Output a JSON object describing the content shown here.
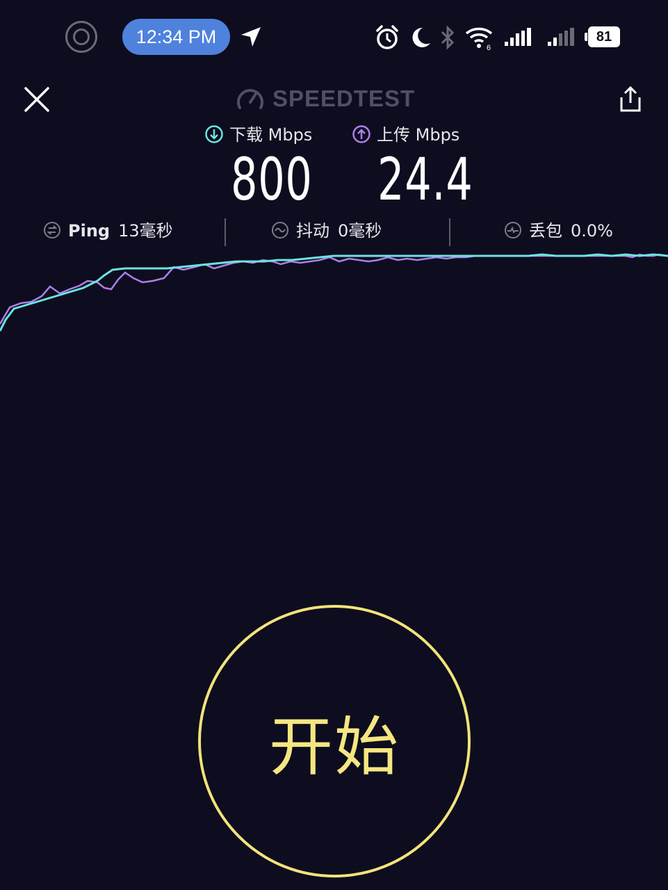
{
  "status_bar": {
    "time": "12:34 PM",
    "wifi_badge": "6",
    "battery": "81"
  },
  "header": {
    "brand": "SPEEDTEST"
  },
  "result": {
    "download": {
      "label": "下载 Mbps",
      "value": "800"
    },
    "upload": {
      "label": "上传 Mbps",
      "value": "24.4"
    }
  },
  "stats": {
    "ping": {
      "label": "Ping",
      "value": "13毫秒"
    },
    "jitter": {
      "label": "抖动",
      "value": "0毫秒"
    },
    "packet_loss": {
      "label": "丢包",
      "value": "0.0%"
    }
  },
  "start_button": {
    "label": "开始"
  },
  "colors": {
    "background": "#0d0d1f",
    "download": "#6ce4e0",
    "upload": "#b07ee8",
    "start": "#f3e37a"
  },
  "icons": {
    "record": "screen-record-icon",
    "location": "location-arrow-icon",
    "alarm": "alarm-icon",
    "moon": "moon-icon",
    "bluetooth": "bluetooth-icon",
    "wifi": "wifi-icon",
    "signal1": "signal-sim1-icon",
    "signal2": "signal-sim2-icon",
    "close": "close-icon",
    "gauge": "gauge-icon",
    "share": "share-icon",
    "download": "download-arrow-icon",
    "upload": "upload-arrow-icon",
    "ping": "ping-icon",
    "jitter": "jitter-icon",
    "packet_loss": "packet-loss-icon"
  }
}
